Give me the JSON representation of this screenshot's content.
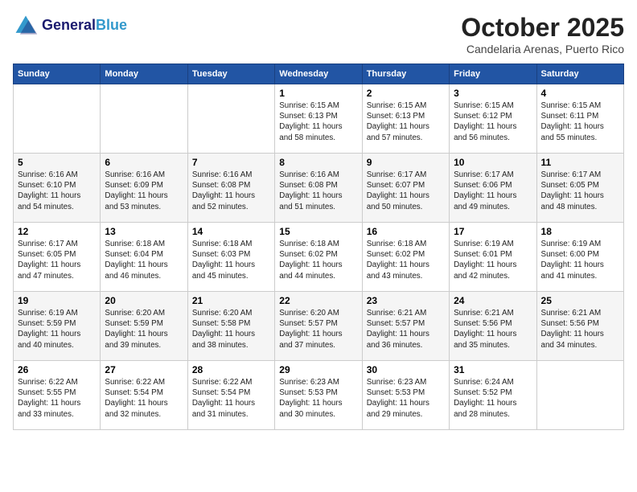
{
  "header": {
    "logo_line1": "General",
    "logo_line2": "Blue",
    "month": "October 2025",
    "location": "Candelaria Arenas, Puerto Rico"
  },
  "days_of_week": [
    "Sunday",
    "Monday",
    "Tuesday",
    "Wednesday",
    "Thursday",
    "Friday",
    "Saturday"
  ],
  "weeks": [
    [
      {
        "day": "",
        "info": ""
      },
      {
        "day": "",
        "info": ""
      },
      {
        "day": "",
        "info": ""
      },
      {
        "day": "1",
        "info": "Sunrise: 6:15 AM\nSunset: 6:13 PM\nDaylight: 11 hours\nand 58 minutes."
      },
      {
        "day": "2",
        "info": "Sunrise: 6:15 AM\nSunset: 6:13 PM\nDaylight: 11 hours\nand 57 minutes."
      },
      {
        "day": "3",
        "info": "Sunrise: 6:15 AM\nSunset: 6:12 PM\nDaylight: 11 hours\nand 56 minutes."
      },
      {
        "day": "4",
        "info": "Sunrise: 6:15 AM\nSunset: 6:11 PM\nDaylight: 11 hours\nand 55 minutes."
      }
    ],
    [
      {
        "day": "5",
        "info": "Sunrise: 6:16 AM\nSunset: 6:10 PM\nDaylight: 11 hours\nand 54 minutes."
      },
      {
        "day": "6",
        "info": "Sunrise: 6:16 AM\nSunset: 6:09 PM\nDaylight: 11 hours\nand 53 minutes."
      },
      {
        "day": "7",
        "info": "Sunrise: 6:16 AM\nSunset: 6:08 PM\nDaylight: 11 hours\nand 52 minutes."
      },
      {
        "day": "8",
        "info": "Sunrise: 6:16 AM\nSunset: 6:08 PM\nDaylight: 11 hours\nand 51 minutes."
      },
      {
        "day": "9",
        "info": "Sunrise: 6:17 AM\nSunset: 6:07 PM\nDaylight: 11 hours\nand 50 minutes."
      },
      {
        "day": "10",
        "info": "Sunrise: 6:17 AM\nSunset: 6:06 PM\nDaylight: 11 hours\nand 49 minutes."
      },
      {
        "day": "11",
        "info": "Sunrise: 6:17 AM\nSunset: 6:05 PM\nDaylight: 11 hours\nand 48 minutes."
      }
    ],
    [
      {
        "day": "12",
        "info": "Sunrise: 6:17 AM\nSunset: 6:05 PM\nDaylight: 11 hours\nand 47 minutes."
      },
      {
        "day": "13",
        "info": "Sunrise: 6:18 AM\nSunset: 6:04 PM\nDaylight: 11 hours\nand 46 minutes."
      },
      {
        "day": "14",
        "info": "Sunrise: 6:18 AM\nSunset: 6:03 PM\nDaylight: 11 hours\nand 45 minutes."
      },
      {
        "day": "15",
        "info": "Sunrise: 6:18 AM\nSunset: 6:02 PM\nDaylight: 11 hours\nand 44 minutes."
      },
      {
        "day": "16",
        "info": "Sunrise: 6:18 AM\nSunset: 6:02 PM\nDaylight: 11 hours\nand 43 minutes."
      },
      {
        "day": "17",
        "info": "Sunrise: 6:19 AM\nSunset: 6:01 PM\nDaylight: 11 hours\nand 42 minutes."
      },
      {
        "day": "18",
        "info": "Sunrise: 6:19 AM\nSunset: 6:00 PM\nDaylight: 11 hours\nand 41 minutes."
      }
    ],
    [
      {
        "day": "19",
        "info": "Sunrise: 6:19 AM\nSunset: 5:59 PM\nDaylight: 11 hours\nand 40 minutes."
      },
      {
        "day": "20",
        "info": "Sunrise: 6:20 AM\nSunset: 5:59 PM\nDaylight: 11 hours\nand 39 minutes."
      },
      {
        "day": "21",
        "info": "Sunrise: 6:20 AM\nSunset: 5:58 PM\nDaylight: 11 hours\nand 38 minutes."
      },
      {
        "day": "22",
        "info": "Sunrise: 6:20 AM\nSunset: 5:57 PM\nDaylight: 11 hours\nand 37 minutes."
      },
      {
        "day": "23",
        "info": "Sunrise: 6:21 AM\nSunset: 5:57 PM\nDaylight: 11 hours\nand 36 minutes."
      },
      {
        "day": "24",
        "info": "Sunrise: 6:21 AM\nSunset: 5:56 PM\nDaylight: 11 hours\nand 35 minutes."
      },
      {
        "day": "25",
        "info": "Sunrise: 6:21 AM\nSunset: 5:56 PM\nDaylight: 11 hours\nand 34 minutes."
      }
    ],
    [
      {
        "day": "26",
        "info": "Sunrise: 6:22 AM\nSunset: 5:55 PM\nDaylight: 11 hours\nand 33 minutes."
      },
      {
        "day": "27",
        "info": "Sunrise: 6:22 AM\nSunset: 5:54 PM\nDaylight: 11 hours\nand 32 minutes."
      },
      {
        "day": "28",
        "info": "Sunrise: 6:22 AM\nSunset: 5:54 PM\nDaylight: 11 hours\nand 31 minutes."
      },
      {
        "day": "29",
        "info": "Sunrise: 6:23 AM\nSunset: 5:53 PM\nDaylight: 11 hours\nand 30 minutes."
      },
      {
        "day": "30",
        "info": "Sunrise: 6:23 AM\nSunset: 5:53 PM\nDaylight: 11 hours\nand 29 minutes."
      },
      {
        "day": "31",
        "info": "Sunrise: 6:24 AM\nSunset: 5:52 PM\nDaylight: 11 hours\nand 28 minutes."
      },
      {
        "day": "",
        "info": ""
      }
    ]
  ]
}
